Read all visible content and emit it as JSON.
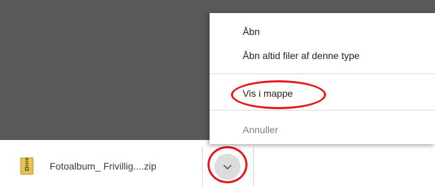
{
  "download": {
    "filename": "Fotoalbum_ Frivillig....zip",
    "file_icon": "zip-file-icon"
  },
  "shelf": {
    "menu_button_icon": "chevron-down-icon"
  },
  "context_menu": {
    "items": [
      {
        "label": "Åbn",
        "enabled": true
      },
      {
        "label": "Åbn altid filer af denne type",
        "enabled": true
      },
      {
        "label": "Vis i mappe",
        "enabled": true,
        "highlighted": true
      },
      {
        "label": "Annuller",
        "enabled": false
      }
    ]
  },
  "colors": {
    "page_background": "#595959",
    "annotation_red": "#e8141d",
    "disabled_text": "#7f7f7f",
    "chevron_button": "#dcdcdc"
  }
}
